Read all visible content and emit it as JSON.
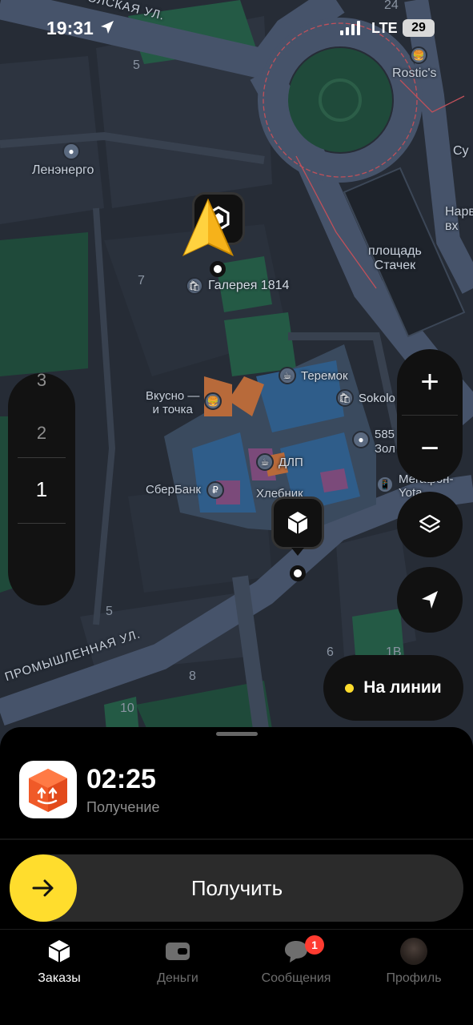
{
  "status_bar": {
    "time": "19:31",
    "network": "LTE",
    "battery": "29"
  },
  "map": {
    "streets": [
      {
        "id": "top",
        "text": "ОЛСКАЯ УЛ."
      },
      {
        "id": "bottom",
        "text": "ПРОМЫШЛЕННАЯ УЛ."
      }
    ],
    "labels": {
      "lenenergo": "Ленэнерго",
      "rostics": "Rostic's",
      "square": "площадь\nСтачек",
      "galereya": "Галерея 1814",
      "teremok": "Теремок",
      "sokolov": "Sokolo",
      "vkusno": "Вкусно —\nи точка",
      "num585": "585\nЗол",
      "dlp": "ДЛП",
      "sberbank": "СберБанк",
      "khlebnik": "Хлебник",
      "megafon": "Мегафон-\nYota",
      "su": "Су",
      "narva": "Нарв\nвх"
    },
    "building_numbers": {
      "n24": "24",
      "n5a": "5",
      "n7": "7",
      "n5b": "5",
      "n8": "8",
      "n10": "10",
      "n6": "6",
      "n1v": "1В"
    }
  },
  "floors": {
    "items": [
      "3",
      "2",
      "1"
    ],
    "selected": "1"
  },
  "controls": {
    "zoom_in": "+",
    "zoom_out": "−"
  },
  "status_pill": {
    "label": "На линии",
    "dot_color": "#ffdd2d"
  },
  "order": {
    "timer": "02:25",
    "status": "Получение"
  },
  "action": {
    "label": "Получить",
    "accent": "#ffdd2d"
  },
  "tabs": [
    {
      "label": "Заказы",
      "icon": "box-icon",
      "active": true
    },
    {
      "label": "Деньги",
      "icon": "wallet-icon",
      "active": false
    },
    {
      "label": "Сообщения",
      "icon": "chat-icon",
      "active": false,
      "badge": "1"
    },
    {
      "label": "Профиль",
      "icon": "avatar",
      "active": false
    }
  ]
}
